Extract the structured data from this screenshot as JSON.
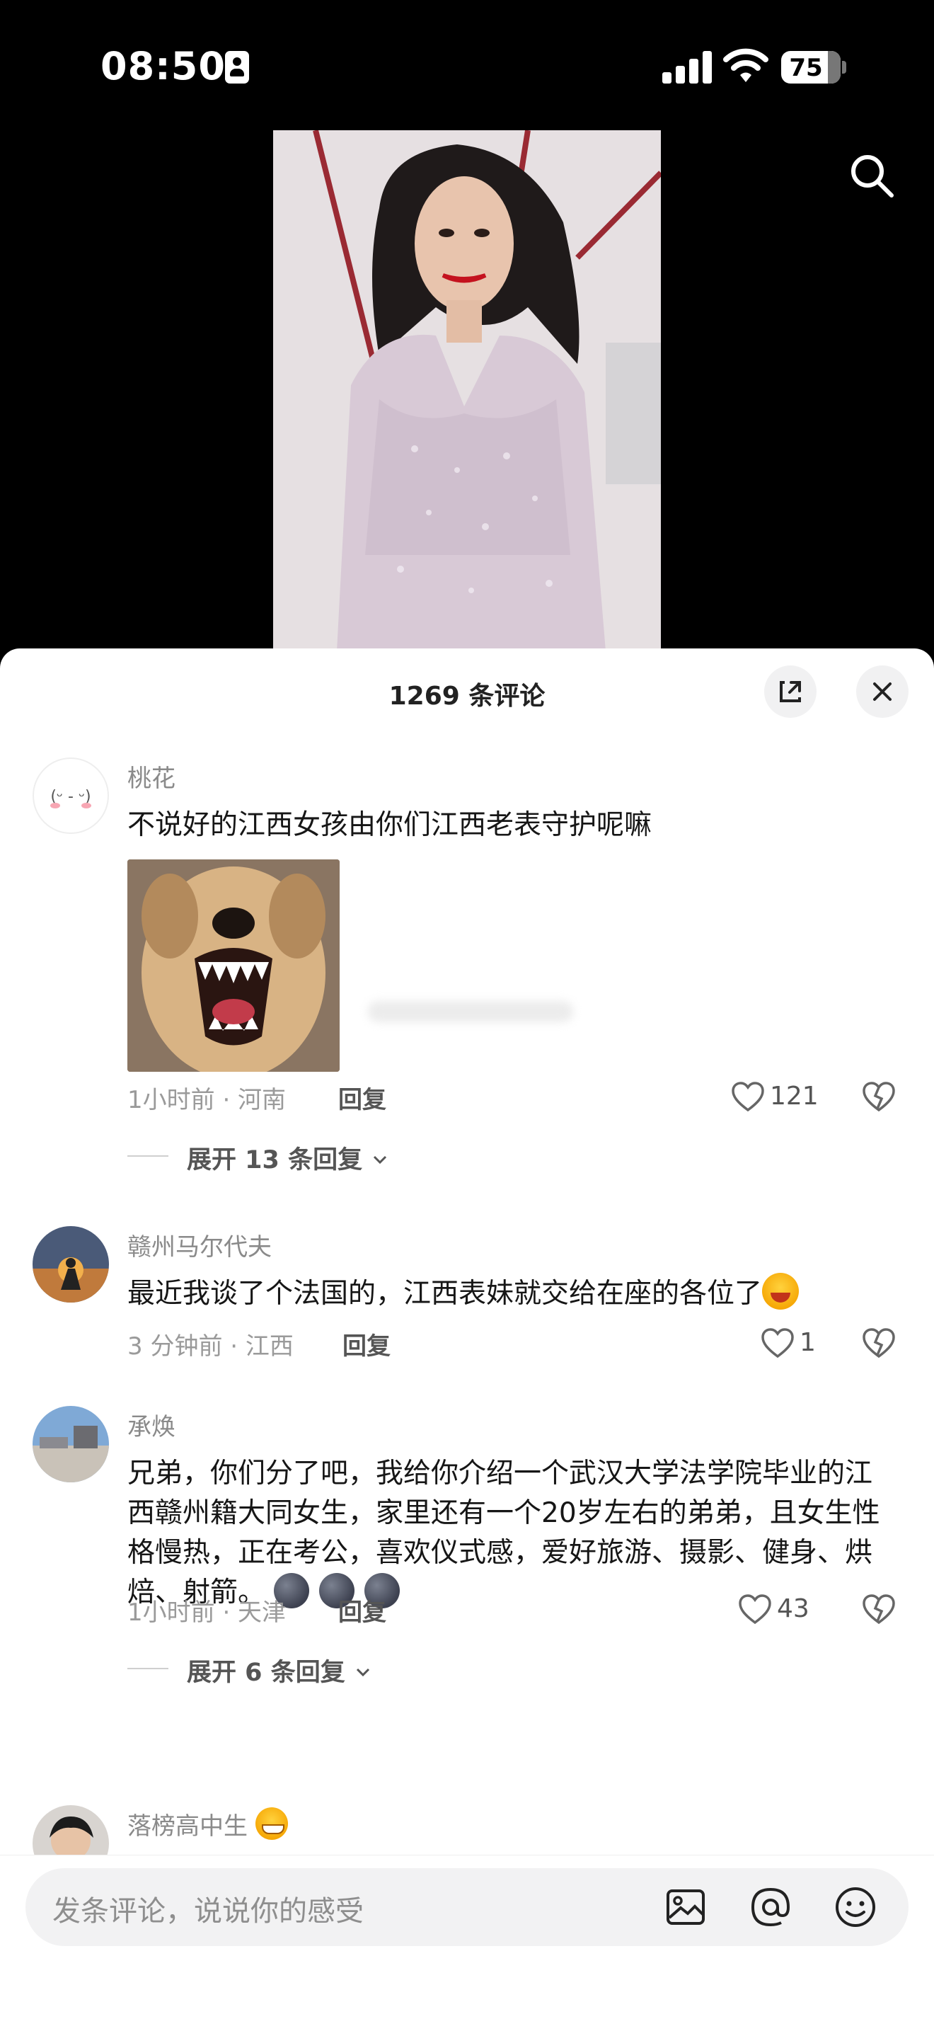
{
  "status_bar": {
    "time": "08:50",
    "battery": "75",
    "battery_level": 0.75
  },
  "sheet": {
    "title": "1269 条评论"
  },
  "comments": [
    {
      "username": "桃花",
      "text": "不说好的江西女孩由你们江西老表守护呢嘛",
      "time_location": "1小时前 · 河南",
      "reply_label": "回复",
      "likes": "121",
      "expand_label": "展开 13 条回复"
    },
    {
      "username": "赣州马尔代夫",
      "text": "最近我谈了个法国的，江西表妹就交给在座的各位了",
      "time_location": "3 分钟前 · 江西",
      "reply_label": "回复",
      "likes": "1"
    },
    {
      "username": "承焕",
      "text": "兄弟，你们分了吧，我给你介绍一个武汉大学法学院毕业的江西赣州籍大同女生，家里还有一个20岁左右的弟弟，且女生性格慢热，正在考公，喜欢仪式感，爱好旅游、摄影、健身、烘焙、射箭。",
      "time_location": "1小时前 · 天津",
      "reply_label": "回复",
      "likes": "43",
      "expand_label": "展开 6 条回复"
    },
    {
      "username": "落榜高中生"
    }
  ],
  "composer": {
    "placeholder": "发条评论，说说你的感受"
  },
  "icons": [
    "id-card-icon",
    "signal-icon",
    "wifi-icon",
    "battery-icon",
    "search-icon",
    "expand-icon",
    "close-icon",
    "heart-icon",
    "broken-heart-icon",
    "chevron-down-icon",
    "image-icon",
    "at-icon",
    "emoji-icon"
  ]
}
